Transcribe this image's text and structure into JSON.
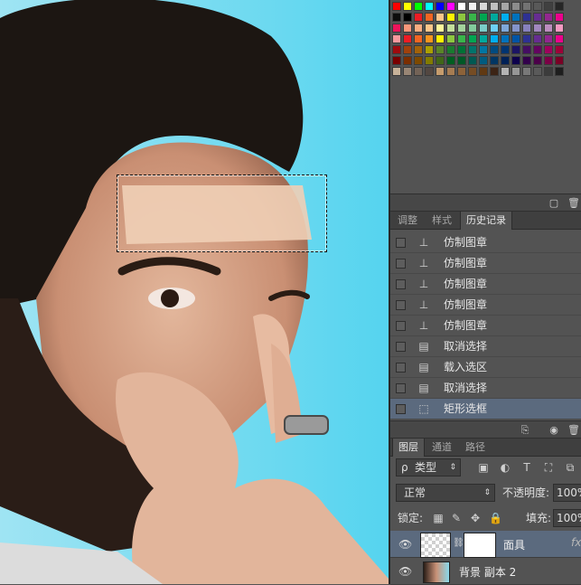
{
  "canvas": {
    "background_colors": [
      "#1a1410",
      "#6ad9f0"
    ]
  },
  "swatches": {
    "rows": [
      [
        "#ff0000",
        "#ffff00",
        "#00ff00",
        "#00ffff",
        "#0000ff",
        "#ff00ff",
        "#ffffff",
        "#f0f0f0",
        "#d9d9d9",
        "#c0c0c0",
        "#a6a6a6",
        "#8c8c8c",
        "#737373",
        "#595959",
        "#404040",
        "#262626"
      ],
      [
        "#0d0d0d",
        "#000000",
        "#ec1c24",
        "#f26522",
        "#fdc68a",
        "#fff200",
        "#8dc63f",
        "#39b54a",
        "#00a651",
        "#00a99d",
        "#00aeef",
        "#0072bc",
        "#2e3192",
        "#662d91",
        "#92278f",
        "#ec008c"
      ],
      [
        "#ed145b",
        "#f7977a",
        "#f9ad81",
        "#fdc68a",
        "#fff79a",
        "#c4df9b",
        "#a3d39c",
        "#82ca9c",
        "#7accc8",
        "#6dcff6",
        "#7ea7d8",
        "#8393ca",
        "#8781bd",
        "#a187be",
        "#bc8dbf",
        "#f49ac2"
      ],
      [
        "#f6989d",
        "#ed1c24",
        "#f26522",
        "#f7941d",
        "#fff200",
        "#8dc73f",
        "#39b54a",
        "#00a651",
        "#00a99d",
        "#00aeef",
        "#0072bc",
        "#0054a6",
        "#2e3192",
        "#662d91",
        "#92278f",
        "#ec008c"
      ],
      [
        "#9e0b0f",
        "#a0410d",
        "#a36209",
        "#aba000",
        "#598527",
        "#197b30",
        "#007236",
        "#00746b",
        "#0076a3",
        "#004b80",
        "#003471",
        "#1b1464",
        "#440e62",
        "#630460",
        "#9e005d",
        "#9e0039"
      ],
      [
        "#790000",
        "#7b2e00",
        "#7d4900",
        "#827b00",
        "#406618",
        "#005e20",
        "#005826",
        "#005952",
        "#005b7f",
        "#003663",
        "#002157",
        "#0d004c",
        "#32004b",
        "#4b0049",
        "#7b0046",
        "#7a0026"
      ],
      [
        "#c7b299",
        "#998675",
        "#736357",
        "#534741",
        "#c69c6d",
        "#a67c52",
        "#8c6239",
        "#754c24",
        "#603913",
        "#3c2415",
        "#b4b4b4",
        "#969696",
        "#787878",
        "#5a5a5a",
        "#3c3c3c",
        "#1e1e1e"
      ]
    ]
  },
  "history_panel": {
    "tabs": [
      "调整",
      "样式",
      "历史记录"
    ],
    "active_tab": "历史记录",
    "items": [
      {
        "label": "仿制图章",
        "icon": "clone-stamp-icon"
      },
      {
        "label": "仿制图章",
        "icon": "clone-stamp-icon"
      },
      {
        "label": "仿制图章",
        "icon": "clone-stamp-icon"
      },
      {
        "label": "仿制图章",
        "icon": "clone-stamp-icon"
      },
      {
        "label": "仿制图章",
        "icon": "clone-stamp-icon"
      },
      {
        "label": "取消选择",
        "icon": "document-icon"
      },
      {
        "label": "载入选区",
        "icon": "document-icon"
      },
      {
        "label": "取消选择",
        "icon": "document-icon"
      },
      {
        "label": "矩形选框",
        "icon": "rect-marquee-icon",
        "selected": true
      }
    ]
  },
  "layers_panel": {
    "tabs": [
      "图层",
      "通道",
      "路径"
    ],
    "active_tab": "图层",
    "filter": {
      "label": "类型",
      "search_glyph": "ρ"
    },
    "blend_mode": "正常",
    "opacity_label": "不透明度:",
    "opacity_value": "100%",
    "lock_label": "锁定:",
    "fill_label": "填充:",
    "fill_value": "100%",
    "layers": [
      {
        "name": "面具",
        "fx": "fx",
        "selected": true
      },
      {
        "name": "背景 副本 2",
        "selected": false
      }
    ],
    "accent_color": "#5b6a7e"
  }
}
